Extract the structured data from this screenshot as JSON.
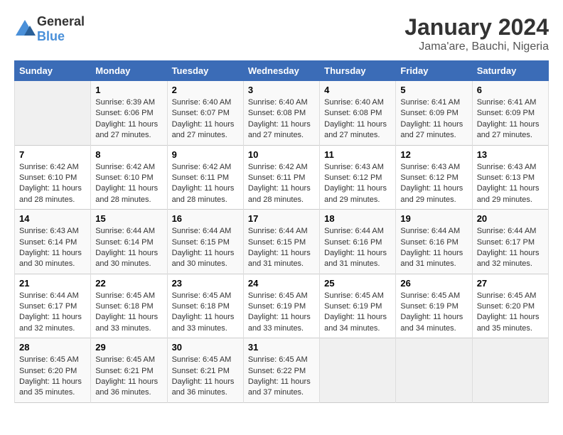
{
  "header": {
    "logo_general": "General",
    "logo_blue": "Blue",
    "title": "January 2024",
    "subtitle": "Jama'are, Bauchi, Nigeria"
  },
  "days_of_week": [
    "Sunday",
    "Monday",
    "Tuesday",
    "Wednesday",
    "Thursday",
    "Friday",
    "Saturday"
  ],
  "weeks": [
    [
      {
        "day": "",
        "empty": true
      },
      {
        "day": "1",
        "sunrise": "6:39 AM",
        "sunset": "6:06 PM",
        "daylight": "11 hours and 27 minutes."
      },
      {
        "day": "2",
        "sunrise": "6:40 AM",
        "sunset": "6:07 PM",
        "daylight": "11 hours and 27 minutes."
      },
      {
        "day": "3",
        "sunrise": "6:40 AM",
        "sunset": "6:08 PM",
        "daylight": "11 hours and 27 minutes."
      },
      {
        "day": "4",
        "sunrise": "6:40 AM",
        "sunset": "6:08 PM",
        "daylight": "11 hours and 27 minutes."
      },
      {
        "day": "5",
        "sunrise": "6:41 AM",
        "sunset": "6:09 PM",
        "daylight": "11 hours and 27 minutes."
      },
      {
        "day": "6",
        "sunrise": "6:41 AM",
        "sunset": "6:09 PM",
        "daylight": "11 hours and 27 minutes."
      }
    ],
    [
      {
        "day": "7",
        "sunrise": "6:42 AM",
        "sunset": "6:10 PM",
        "daylight": "11 hours and 28 minutes."
      },
      {
        "day": "8",
        "sunrise": "6:42 AM",
        "sunset": "6:10 PM",
        "daylight": "11 hours and 28 minutes."
      },
      {
        "day": "9",
        "sunrise": "6:42 AM",
        "sunset": "6:11 PM",
        "daylight": "11 hours and 28 minutes."
      },
      {
        "day": "10",
        "sunrise": "6:42 AM",
        "sunset": "6:11 PM",
        "daylight": "11 hours and 28 minutes."
      },
      {
        "day": "11",
        "sunrise": "6:43 AM",
        "sunset": "6:12 PM",
        "daylight": "11 hours and 29 minutes."
      },
      {
        "day": "12",
        "sunrise": "6:43 AM",
        "sunset": "6:12 PM",
        "daylight": "11 hours and 29 minutes."
      },
      {
        "day": "13",
        "sunrise": "6:43 AM",
        "sunset": "6:13 PM",
        "daylight": "11 hours and 29 minutes."
      }
    ],
    [
      {
        "day": "14",
        "sunrise": "6:43 AM",
        "sunset": "6:14 PM",
        "daylight": "11 hours and 30 minutes."
      },
      {
        "day": "15",
        "sunrise": "6:44 AM",
        "sunset": "6:14 PM",
        "daylight": "11 hours and 30 minutes."
      },
      {
        "day": "16",
        "sunrise": "6:44 AM",
        "sunset": "6:15 PM",
        "daylight": "11 hours and 30 minutes."
      },
      {
        "day": "17",
        "sunrise": "6:44 AM",
        "sunset": "6:15 PM",
        "daylight": "11 hours and 31 minutes."
      },
      {
        "day": "18",
        "sunrise": "6:44 AM",
        "sunset": "6:16 PM",
        "daylight": "11 hours and 31 minutes."
      },
      {
        "day": "19",
        "sunrise": "6:44 AM",
        "sunset": "6:16 PM",
        "daylight": "11 hours and 31 minutes."
      },
      {
        "day": "20",
        "sunrise": "6:44 AM",
        "sunset": "6:17 PM",
        "daylight": "11 hours and 32 minutes."
      }
    ],
    [
      {
        "day": "21",
        "sunrise": "6:44 AM",
        "sunset": "6:17 PM",
        "daylight": "11 hours and 32 minutes."
      },
      {
        "day": "22",
        "sunrise": "6:45 AM",
        "sunset": "6:18 PM",
        "daylight": "11 hours and 33 minutes."
      },
      {
        "day": "23",
        "sunrise": "6:45 AM",
        "sunset": "6:18 PM",
        "daylight": "11 hours and 33 minutes."
      },
      {
        "day": "24",
        "sunrise": "6:45 AM",
        "sunset": "6:19 PM",
        "daylight": "11 hours and 33 minutes."
      },
      {
        "day": "25",
        "sunrise": "6:45 AM",
        "sunset": "6:19 PM",
        "daylight": "11 hours and 34 minutes."
      },
      {
        "day": "26",
        "sunrise": "6:45 AM",
        "sunset": "6:19 PM",
        "daylight": "11 hours and 34 minutes."
      },
      {
        "day": "27",
        "sunrise": "6:45 AM",
        "sunset": "6:20 PM",
        "daylight": "11 hours and 35 minutes."
      }
    ],
    [
      {
        "day": "28",
        "sunrise": "6:45 AM",
        "sunset": "6:20 PM",
        "daylight": "11 hours and 35 minutes."
      },
      {
        "day": "29",
        "sunrise": "6:45 AM",
        "sunset": "6:21 PM",
        "daylight": "11 hours and 36 minutes."
      },
      {
        "day": "30",
        "sunrise": "6:45 AM",
        "sunset": "6:21 PM",
        "daylight": "11 hours and 36 minutes."
      },
      {
        "day": "31",
        "sunrise": "6:45 AM",
        "sunset": "6:22 PM",
        "daylight": "11 hours and 37 minutes."
      },
      {
        "day": "",
        "empty": true
      },
      {
        "day": "",
        "empty": true
      },
      {
        "day": "",
        "empty": true
      }
    ]
  ]
}
